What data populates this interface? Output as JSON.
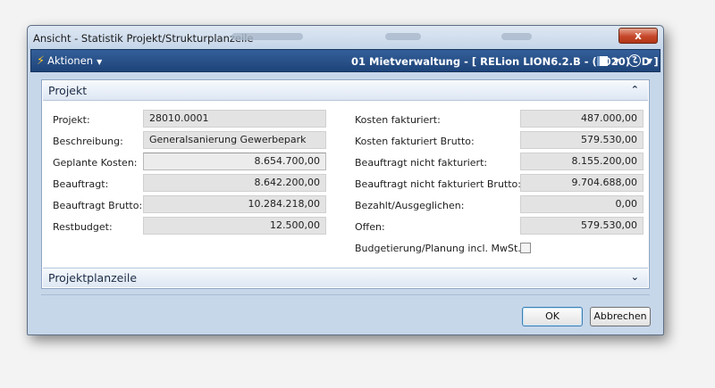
{
  "window": {
    "title": "Ansicht - Statistik Projekt/Strukturplanzeile",
    "close_label": "x"
  },
  "toolbar": {
    "actions_label": "Aktionen",
    "actions_icon": "lightning-icon",
    "record_title": "01 Mietverwaltung - [ RELion LION6.2.B - (9020) - D ]",
    "help_label": "?"
  },
  "sections": {
    "projekt": {
      "title": "Projekt",
      "toggle": "^"
    },
    "projektplanzeile": {
      "title": "Projektplanzeile",
      "toggle": "v"
    }
  },
  "left_fields": [
    {
      "label": "Projekt:",
      "value": "28010.0001"
    },
    {
      "label": "Beschreibung:",
      "value": "Generalsanierung Gewerbepark"
    },
    {
      "label": "Geplante Kosten:",
      "value": "8.654.700,00"
    },
    {
      "label": "Beauftragt:",
      "value": "8.642.200,00"
    },
    {
      "label": "Beauftragt Brutto:",
      "value": "10.284.218,00"
    },
    {
      "label": "Restbudget:",
      "value": "12.500,00"
    }
  ],
  "right_fields": [
    {
      "label": "Kosten fakturiert:",
      "value": "487.000,00"
    },
    {
      "label": "Kosten fakturiert Brutto:",
      "value": "579.530,00"
    },
    {
      "label": "Beauftragt nicht fakturiert:",
      "value": "8.155.200,00"
    },
    {
      "label": "Beauftragt nicht fakturiert Brutto:",
      "value": "9.704.688,00"
    },
    {
      "label": "Bezahlt/Ausgeglichen:",
      "value": "0,00"
    },
    {
      "label": "Offen:",
      "value": "579.530,00"
    }
  ],
  "budget_checkbox": {
    "label": "Budgetierung/Planung incl. MwSt.:",
    "checked": false
  },
  "buttons": {
    "ok": "OK",
    "cancel": "Abbrechen"
  },
  "colors": {
    "toolbar": "#1e4479",
    "titlebar": "#c4d5e9",
    "frame": "#c7d7ea"
  }
}
